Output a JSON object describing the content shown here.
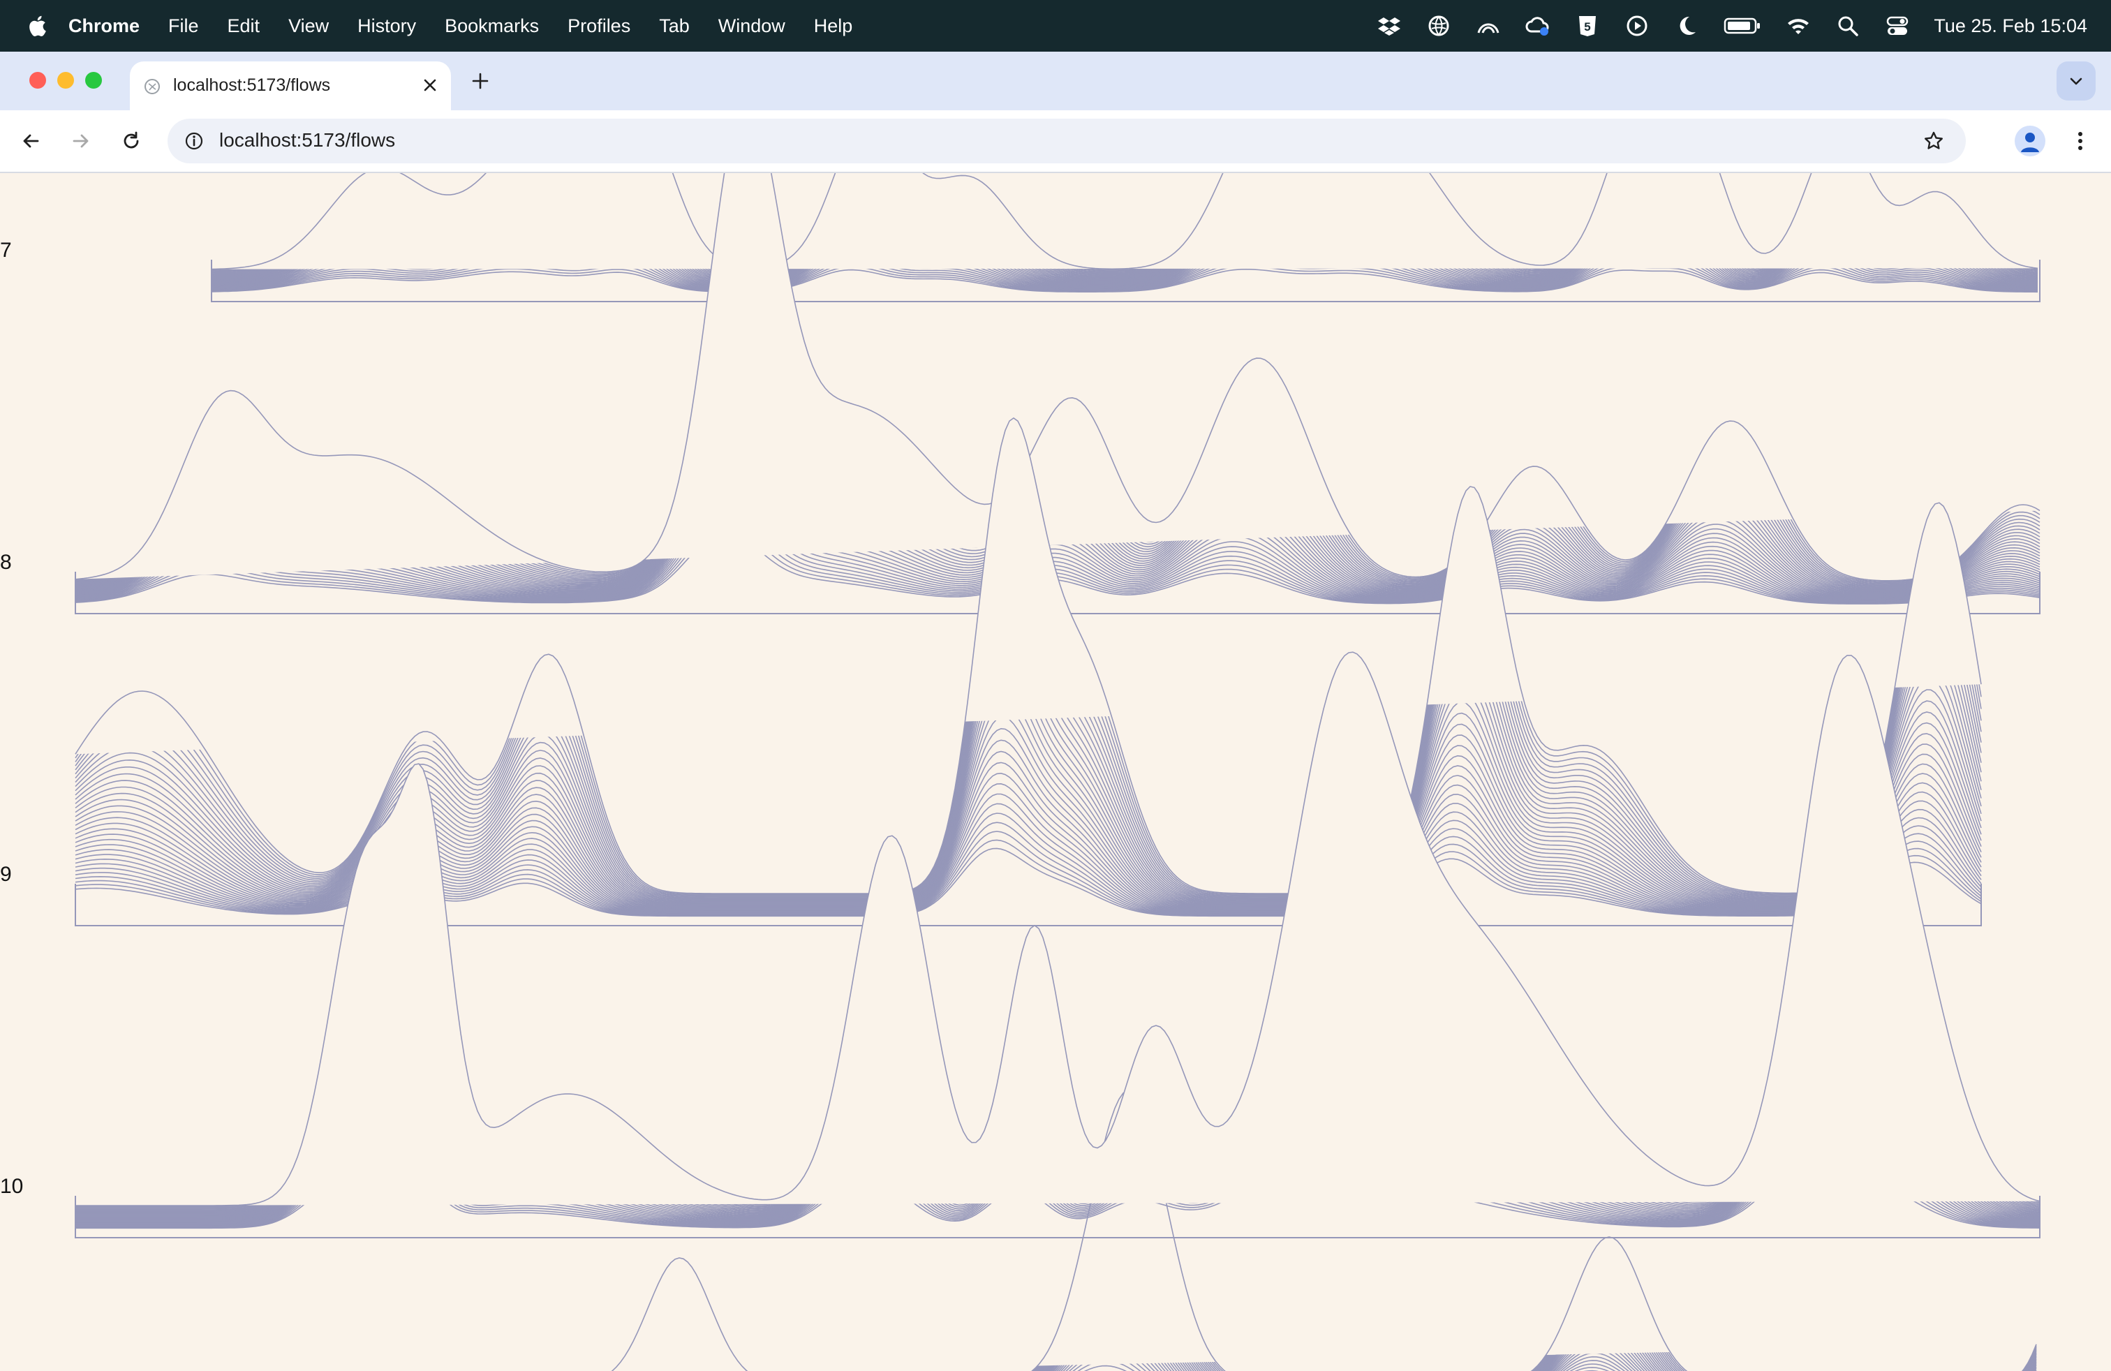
{
  "menubar": {
    "app_name": "Chrome",
    "items": [
      "File",
      "Edit",
      "View",
      "History",
      "Bookmarks",
      "Profiles",
      "Tab",
      "Window",
      "Help"
    ],
    "status_icons": [
      "dropbox-icon",
      "globe-app-icon",
      "arc-icon",
      "cloud-sync-icon",
      "five-app-icon",
      "play-circle-icon",
      "moon-icon",
      "battery-icon",
      "wifi-icon",
      "search-icon",
      "control-center-icon"
    ],
    "clock": "Tue 25. Feb  15:04"
  },
  "browser": {
    "tab_title": "localhost:5173/flows",
    "url": "localhost:5173/flows",
    "colors": {
      "tabstrip": "#dfe7f8",
      "close": "#ff5f57",
      "minimize": "#febc2e",
      "maximize": "#28c840"
    }
  },
  "page": {
    "row_labels": [
      "7",
      "8",
      "9",
      "10"
    ],
    "line_color": "#9597b9",
    "background": "#faf3ea"
  }
}
